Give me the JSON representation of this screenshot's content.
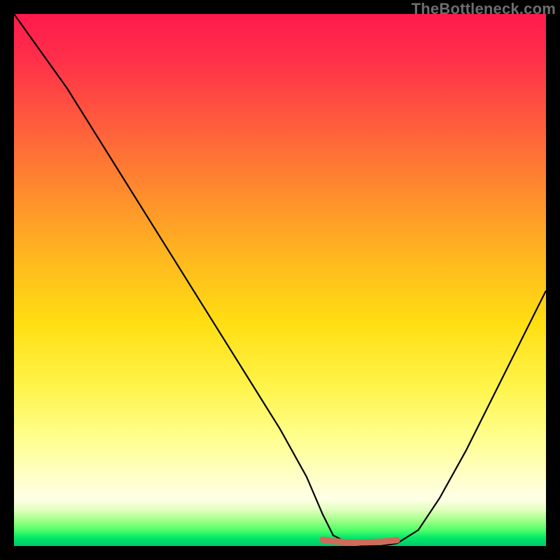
{
  "watermark": {
    "text": "TheBottleneck.com"
  },
  "colors": {
    "frame": "#000000",
    "curve": "#000000",
    "bottom_marker": "#d06a5a",
    "gradient_top": "#ff1a4d",
    "gradient_mid": "#ffde12",
    "gradient_bottom": "#00c86a"
  },
  "chart_data": {
    "type": "line",
    "title": "",
    "xlabel": "",
    "ylabel": "",
    "xlim": [
      0,
      100
    ],
    "ylim": [
      0,
      100
    ],
    "series": [
      {
        "name": "bottleneck-curve",
        "x": [
          0,
          5,
          10,
          15,
          20,
          25,
          30,
          35,
          40,
          45,
          50,
          55,
          58,
          60,
          63,
          66,
          69,
          72,
          76,
          80,
          85,
          90,
          95,
          100
        ],
        "values": [
          100,
          93,
          86,
          78,
          70,
          62,
          54,
          46,
          38,
          30,
          22,
          13,
          6,
          2,
          0.5,
          0,
          0,
          0.5,
          3,
          9,
          18,
          28,
          38,
          48
        ]
      },
      {
        "name": "optimal-band-marker",
        "x": [
          58,
          60,
          63,
          66,
          69,
          72
        ],
        "values": [
          1.2,
          0.9,
          0.7,
          0.7,
          0.8,
          1.1
        ]
      }
    ],
    "annotations": [
      {
        "text": "TheBottleneck.com",
        "role": "watermark",
        "position": "top-right"
      }
    ]
  }
}
